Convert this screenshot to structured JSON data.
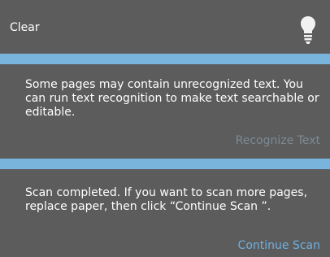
{
  "header": {
    "title": "Clear",
    "icon": "lightbulb-icon"
  },
  "colors": {
    "panel_background": "#5c5c5c",
    "divider": "#78b4dc",
    "text": "#ffffff",
    "link_disabled": "#7d8a94",
    "link_active": "#6fb0e0",
    "icon": "#f2f2f2"
  },
  "sections": [
    {
      "message": "Some pages may contain unrecognized text. You can run text recognition to make text searchable or editable.",
      "action_label": "Recognize Text",
      "action_enabled": false
    },
    {
      "message": "Scan completed. If you want to scan more pages, replace paper, then click “Continue Scan ”.",
      "action_label": "Continue Scan",
      "action_enabled": true
    }
  ]
}
